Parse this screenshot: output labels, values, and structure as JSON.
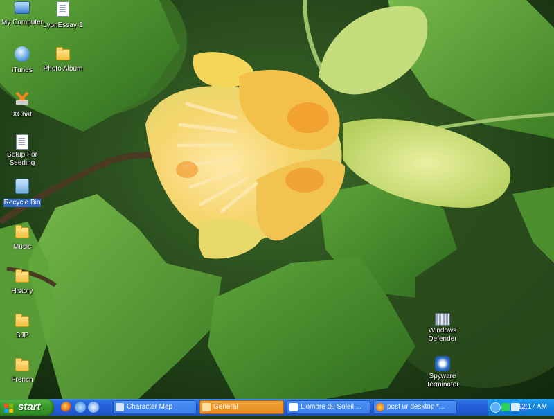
{
  "desktop": {
    "icons": [
      {
        "label": "My Computer",
        "icon": "my-computer-icon"
      },
      {
        "label": "LyonEssay-1",
        "icon": "word-document-icon"
      },
      {
        "label": "iTunes",
        "icon": "itunes-icon"
      },
      {
        "label": "Photo Album",
        "icon": "folder-icon"
      },
      {
        "label": "XChat",
        "icon": "xchat-icon"
      },
      {
        "label": "Setup For Seeding",
        "icon": "document-icon"
      },
      {
        "label": "Recycle Bin",
        "icon": "recycle-bin-icon",
        "selected": true
      },
      {
        "label": "Music",
        "icon": "folder-icon"
      },
      {
        "label": "History",
        "icon": "folder-icon"
      },
      {
        "label": "SJP",
        "icon": "folder-icon"
      },
      {
        "label": "French",
        "icon": "folder-icon"
      },
      {
        "label": "Windows Defender",
        "icon": "windows-defender-icon"
      },
      {
        "label": "Spyware Terminator",
        "icon": "spyware-terminator-icon"
      }
    ]
  },
  "taskbar": {
    "start_label": "start",
    "quick_launch": [
      "firefox-icon",
      "internet-explorer-icon",
      "media-icon"
    ],
    "tasks": [
      {
        "label": "Character Map",
        "active": false
      },
      {
        "label": "General",
        "active": true
      },
      {
        "label": "L'ombre du Soleil ...",
        "active": false
      },
      {
        "label": "post ur desktop *...",
        "active": false
      }
    ],
    "tray_icons": [
      "network-icon",
      "volume-icon",
      "bluetooth-icon"
    ],
    "clock": "12:17 AM"
  },
  "colors": {
    "taskbar_blue": "#245edb",
    "start_green": "#3a9a2c",
    "active_task_orange": "#e88a1a",
    "selection_blue": "#316ac5"
  }
}
